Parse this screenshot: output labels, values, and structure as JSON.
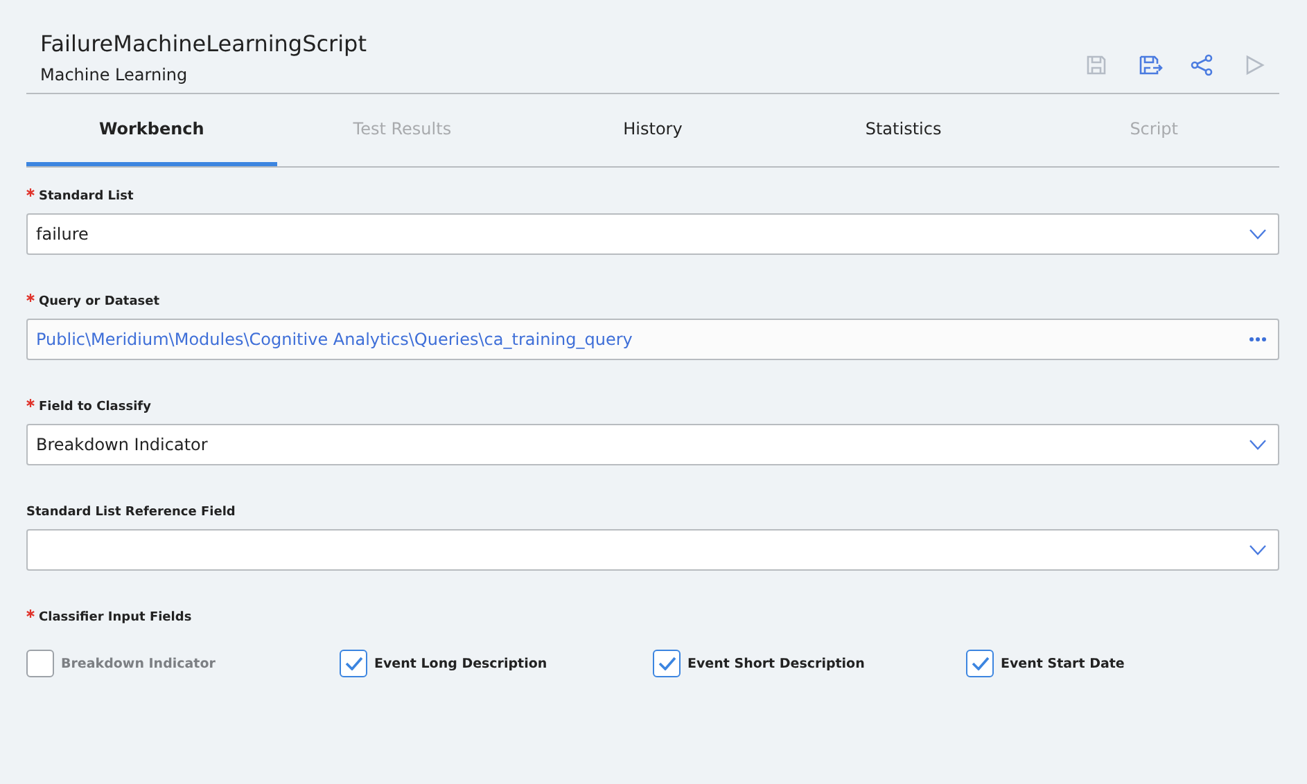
{
  "header": {
    "title": "FailureMachineLearningScript",
    "subtitle": "Machine Learning"
  },
  "toolbar": [
    {
      "kind": "save",
      "disabled": true
    },
    {
      "kind": "save-as",
      "disabled": false
    },
    {
      "kind": "share",
      "disabled": false
    },
    {
      "kind": "run",
      "disabled": true
    }
  ],
  "tabs": [
    {
      "label": "Workbench",
      "selected": true,
      "disabled": false
    },
    {
      "label": "Test Results",
      "selected": false,
      "disabled": true
    },
    {
      "label": "History",
      "selected": false,
      "disabled": false
    },
    {
      "label": "Statistics",
      "selected": false,
      "disabled": false
    },
    {
      "label": "Script",
      "selected": false,
      "disabled": true
    }
  ],
  "fields": [
    {
      "label": "Standard List",
      "required": true,
      "kind": "select",
      "value": "failure"
    },
    {
      "label": "Query or Dataset",
      "required": true,
      "kind": "browse",
      "value": "Public\\Meridium\\Modules\\Cognitive Analytics\\Queries\\ca_training_query"
    },
    {
      "label": "Field to Classify",
      "required": true,
      "kind": "select",
      "value": "Breakdown Indicator"
    },
    {
      "label": "Standard List Reference Field",
      "required": false,
      "kind": "select"
    }
  ],
  "classifier": {
    "label": "Classifier Input Fields",
    "required": true,
    "options": [
      {
        "label": "Breakdown Indicator",
        "checked": false,
        "disabled": true
      },
      {
        "label": "Event Long Description",
        "checked": true,
        "disabled": false
      },
      {
        "label": "Event Short Description",
        "checked": true,
        "disabled": false
      },
      {
        "label": "Event Start Date",
        "checked": true,
        "disabled": false
      }
    ]
  }
}
